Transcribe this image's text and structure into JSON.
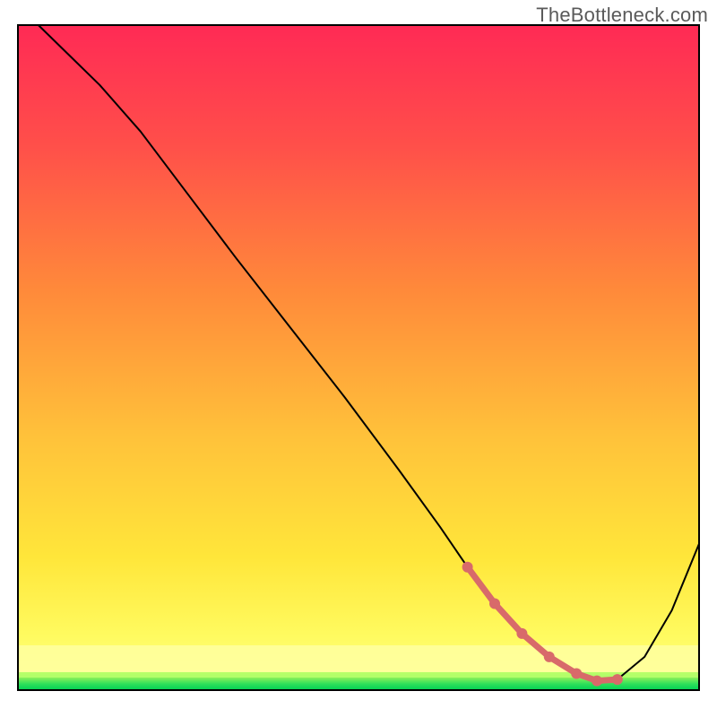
{
  "watermark": "TheBottleneck.com",
  "chart_data": {
    "type": "line",
    "title": "",
    "xlabel": "",
    "ylabel": "",
    "xlim": [
      0,
      100
    ],
    "ylim": [
      0,
      100
    ],
    "grid": false,
    "legend": false,
    "background_gradient": {
      "top_color": "#ff2a55",
      "mid_color": "#ffd23f",
      "bottom_color": "#ffff90",
      "band_color": "#00e05a"
    },
    "series": [
      {
        "name": "curve",
        "color": "#000000",
        "stroke_width": 2,
        "x": [
          3,
          8,
          12,
          18,
          25,
          32,
          40,
          48,
          56,
          62,
          66,
          70,
          74,
          78,
          82,
          85,
          88,
          92,
          96,
          100
        ],
        "y": [
          100,
          95,
          91,
          84,
          74.5,
          65,
          54.5,
          44,
          33,
          24.5,
          18.5,
          13,
          8.5,
          5,
          2.5,
          1.4,
          1.6,
          5,
          12,
          22
        ]
      },
      {
        "name": "highlight-band",
        "color": "#d86a6a",
        "stroke_width": 7,
        "linecap": "round",
        "x": [
          66,
          70,
          74,
          78,
          82,
          85,
          88
        ],
        "y": [
          18.5,
          13,
          8.5,
          5,
          2.5,
          1.4,
          1.6
        ]
      }
    ],
    "annotations": []
  }
}
